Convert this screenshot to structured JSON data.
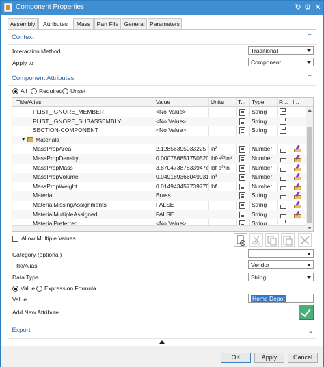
{
  "window": {
    "title": "Component Properties"
  },
  "tabs": [
    "Assembly",
    "Attributes",
    "Mass",
    "Part File",
    "General",
    "Parameters"
  ],
  "context": {
    "title": "Context",
    "interaction_method_label": "Interaction Method",
    "interaction_method_value": "Traditional",
    "apply_to_label": "Apply to",
    "apply_to_value": "Component"
  },
  "component_attributes": {
    "title": "Component Attributes",
    "filter": {
      "all": "All",
      "required": "Required",
      "unset": "Unset",
      "selected": "All"
    },
    "columns": [
      "Title/Alias",
      "Value",
      "Units",
      "T...",
      "Type",
      "R...",
      "I..."
    ],
    "rows": [
      {
        "indent": 2,
        "title": "PLIST_IGNORE_MEMBER",
        "value": "<No Value>",
        "units": "",
        "type": "String",
        "icon": "save"
      },
      {
        "indent": 2,
        "title": "PLIST_IGNORE_SUBASSEMBLY",
        "value": "<No Value>",
        "units": "",
        "type": "String",
        "icon": "save"
      },
      {
        "indent": 2,
        "title": "SECTION-COMPONENT",
        "value": "<No Value>",
        "units": "",
        "type": "String",
        "icon": "save"
      },
      {
        "indent": 1,
        "group": true,
        "title": "Materials"
      },
      {
        "indent": 2,
        "title": "MassPropArea",
        "value": "2.12856395033225",
        "units": "in²",
        "type": "Number",
        "icon": "lock",
        "edit": true
      },
      {
        "indent": 2,
        "title": "MassPropDensity",
        "value": "0.000786851750520...",
        "units": "lbf·s²/in⁴",
        "type": "Number",
        "icon": "lock",
        "edit": true
      },
      {
        "indent": 2,
        "title": "MassPropMass",
        "value": "3.87047387833947e...",
        "units": "lbf·s²/in",
        "type": "Number",
        "icon": "lock",
        "edit": true
      },
      {
        "indent": 2,
        "title": "MassPropVolume",
        "value": "0.0491893660499319",
        "units": "in³",
        "type": "Number",
        "icon": "lock",
        "edit": true
      },
      {
        "indent": 2,
        "title": "MassPropWeight",
        "value": "0.0149434577397707",
        "units": "lbf",
        "type": "Number",
        "icon": "lock",
        "edit": true
      },
      {
        "indent": 2,
        "title": "Material",
        "value": "Brass",
        "units": "",
        "type": "String",
        "icon": "lock",
        "edit": true
      },
      {
        "indent": 2,
        "title": "MaterialMissingAssignments",
        "value": "FALSE",
        "units": "",
        "type": "String",
        "icon": "lock",
        "edit": true
      },
      {
        "indent": 2,
        "title": "MaterialMultipleAssigned",
        "value": "FALSE",
        "units": "",
        "type": "String",
        "icon": "lock",
        "edit": true
      },
      {
        "indent": 2,
        "title": "MaterialPreferred",
        "value": "<No Value>",
        "units": "",
        "type": "String",
        "icon": "save"
      }
    ],
    "allow_multiple_label": "Allow Multiple Values",
    "category_label": "Category (optional)",
    "category_value": "",
    "title_alias_label": "Title/Alias",
    "title_alias_value": "Vendor",
    "data_type_label": "Data Type",
    "data_type_value": "String",
    "value_mode": {
      "value": "Value",
      "expression": "Expression Formula"
    },
    "value_label": "Value",
    "value_input": "Home Depot",
    "add_new_label": "Add New Attribute"
  },
  "export": {
    "title": "Export"
  },
  "footer": {
    "ok": "OK",
    "apply": "Apply",
    "cancel": "Cancel"
  },
  "colors": {
    "titlebar": "#3f8fd2",
    "section_text": "#2a64a8",
    "selection": "#2f75c9",
    "add_button": "#4caf7a"
  }
}
